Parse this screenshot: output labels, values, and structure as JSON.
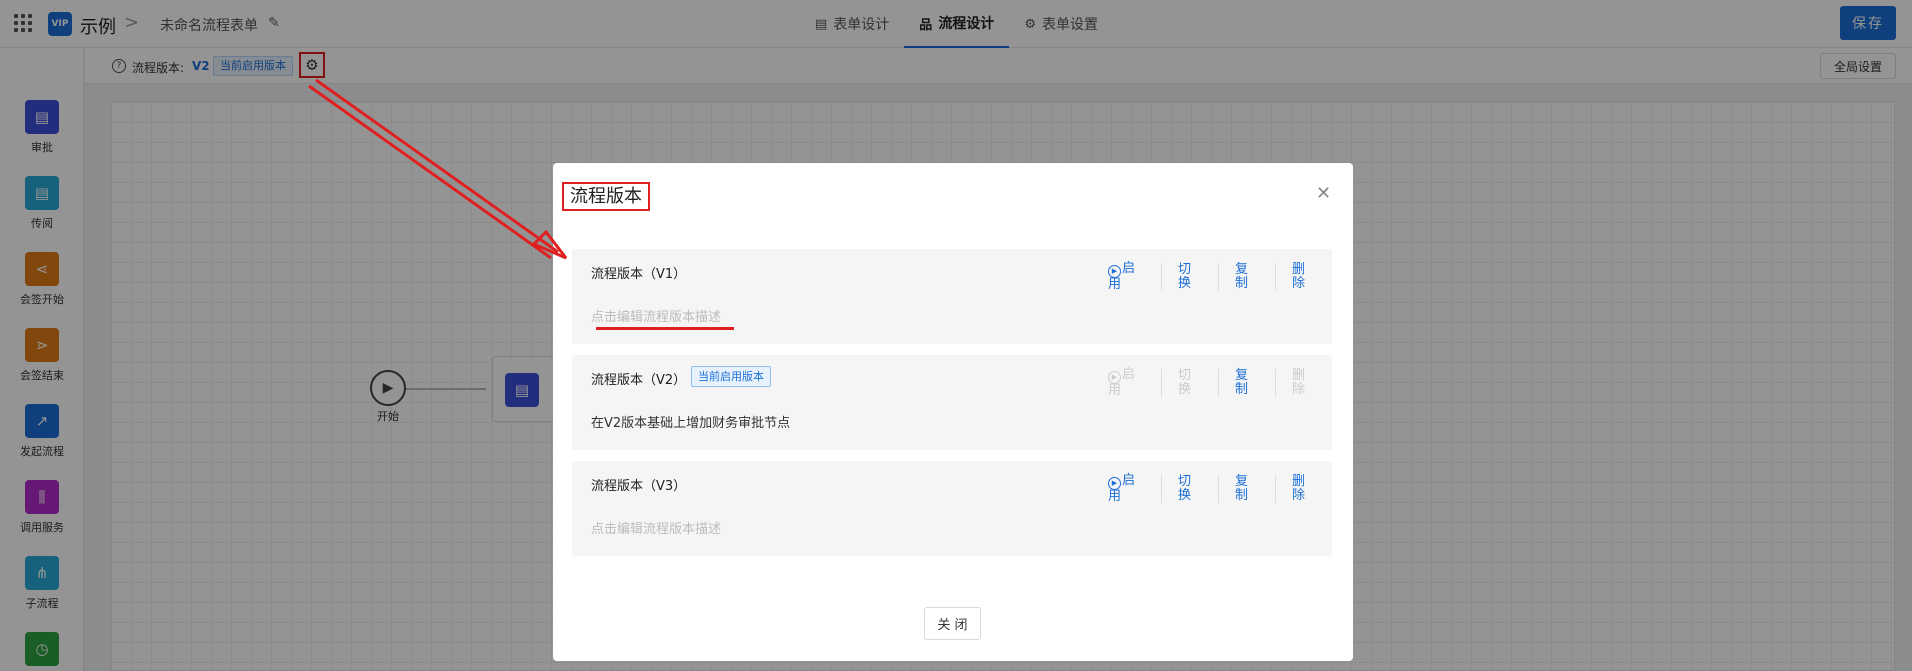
{
  "header": {
    "app_logo_text": "VIP",
    "app_name": "示例",
    "crumb_separator": ">",
    "form_name": "未命名流程表单",
    "tabs": [
      {
        "label": "表单设计",
        "icon": "document-icon"
      },
      {
        "label": "流程设计",
        "icon": "flow-icon"
      },
      {
        "label": "表单设置",
        "icon": "gear-icon"
      }
    ],
    "save_label": "保存"
  },
  "sidebar": {
    "nodes": [
      {
        "label": "审批",
        "color": "#3d4fd9",
        "icon": "approve-icon"
      },
      {
        "label": "传阅",
        "color": "#27a9d6",
        "icon": "circulate-icon"
      },
      {
        "label": "会签开始",
        "color": "#e07a16",
        "icon": "countersign-start-icon"
      },
      {
        "label": "会签结束",
        "color": "#e07a16",
        "icon": "countersign-end-icon"
      },
      {
        "label": "发起流程",
        "color": "#1b6fd8",
        "icon": "launch-flow-icon"
      },
      {
        "label": "调用服务",
        "color": "#b02bc9",
        "icon": "service-icon"
      },
      {
        "label": "子流程",
        "color": "#27a9d6",
        "icon": "subflow-icon"
      },
      {
        "label": "",
        "color": "#2ea043",
        "icon": "timer-icon"
      }
    ]
  },
  "subbar": {
    "version_label": "流程版本:",
    "version_value": "V2",
    "version_badge": "当前启用版本",
    "global_settings_label": "全局设置"
  },
  "canvas": {
    "start_label": "开始"
  },
  "dialog": {
    "title": "流程版本",
    "close_label": "关 闭",
    "actions": {
      "enable": "启用",
      "switch": "切换",
      "copy": "复制",
      "delete": "删除"
    },
    "versions": [
      {
        "name": "流程版本（V1）",
        "badge": "",
        "description": "点击编辑流程版本描述",
        "is_placeholder": true,
        "active": false
      },
      {
        "name": "流程版本（V2）",
        "badge": "当前启用版本",
        "description": "在V2版本基础上增加财务审批节点",
        "is_placeholder": false,
        "active": true
      },
      {
        "name": "流程版本（V3）",
        "badge": "",
        "description": "点击编辑流程版本描述",
        "is_placeholder": true,
        "active": false
      }
    ]
  }
}
